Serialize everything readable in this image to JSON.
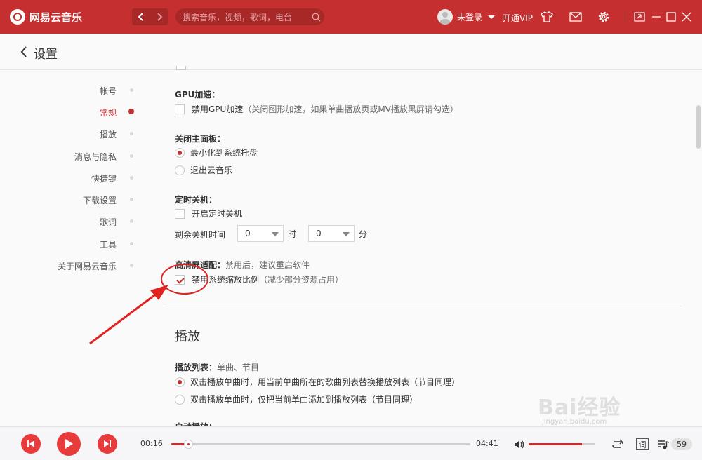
{
  "app": {
    "title": "网易云音乐"
  },
  "search": {
    "placeholder": "搜索音乐，视频，歌词，电台"
  },
  "user": {
    "name": "未登录"
  },
  "header": {
    "vip_label": "开通VIP"
  },
  "page": {
    "title": "设置"
  },
  "sidebar": {
    "items": [
      {
        "label": "帐号"
      },
      {
        "label": "常规",
        "active": true
      },
      {
        "label": "播放"
      },
      {
        "label": "消息与隐私"
      },
      {
        "label": "快捷键"
      },
      {
        "label": "下载设置"
      },
      {
        "label": "歌词"
      },
      {
        "label": "工具"
      },
      {
        "label": "关于网易云音乐"
      }
    ]
  },
  "general": {
    "gpu": {
      "label": "GPU加速：",
      "option": "禁用GPU加速",
      "note": "（关闭图形加速，如果单曲播放页或MV播放黑屏请勾选）",
      "checked": false
    },
    "close_panel": {
      "label": "关闭主面板：",
      "options": [
        "最小化到系统托盘",
        "退出云音乐"
      ],
      "selected": "最小化到系统托盘"
    },
    "shutdown": {
      "label": "定时关机：",
      "option": "开启定时关机",
      "checked": false,
      "remaining_label": "剩余关机时间",
      "hours_value": "0",
      "hours_unit": "时",
      "minutes_value": "0",
      "minutes_unit": "分"
    },
    "hidpi": {
      "label": "高清屏适配：",
      "hint": "禁用后，建议重启软件",
      "option": "禁用系统缩放比例",
      "note": "（减少部分资源占用）",
      "checked": true
    }
  },
  "playback": {
    "section_title": "播放",
    "playlist": {
      "label": "播放列表：",
      "hint": "单曲、节目",
      "options": [
        "双击播放单曲时，用当前单曲所在的歌曲列表替换播放列表（节目同理）",
        "双击播放单曲时，仅把当前单曲添加到播放列表（节目同理）"
      ],
      "selected_index": 0
    },
    "partial_label": "自动播放："
  },
  "watermark": {
    "main": "Bai经验",
    "sub": "jingyan.baidu.com"
  },
  "player": {
    "current_time": "00:16",
    "total_time": "04:41",
    "progress": 0.057,
    "volume": 0.8,
    "lyric_label": "词",
    "playlist_count": "59"
  },
  "colors": {
    "accent": "#c62f2f",
    "play_button": "#e83c3c",
    "annotation": "#e02222"
  }
}
